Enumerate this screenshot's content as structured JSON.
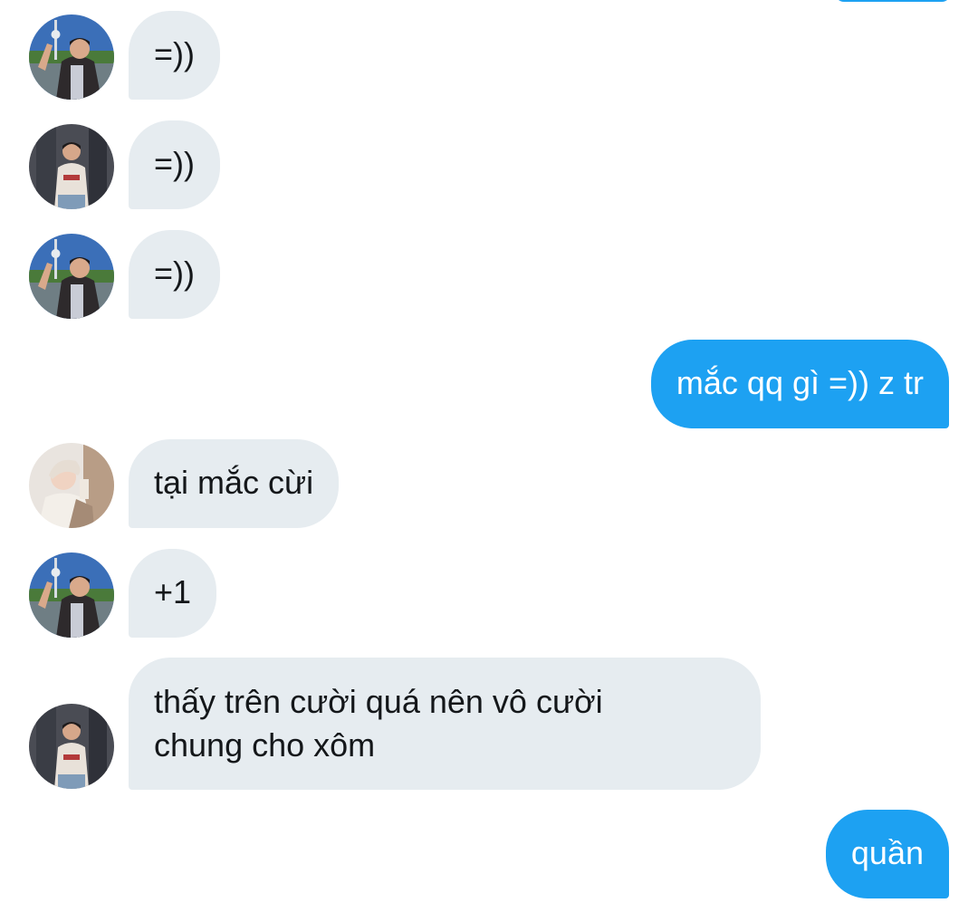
{
  "colors": {
    "incoming_bubble": "#e6ecf0",
    "outgoing_bubble": "#1da1f2",
    "incoming_text": "#14171a",
    "outgoing_text": "#ffffff"
  },
  "messages": [
    {
      "side": "incoming",
      "avatar": "selfie-blue-sky-avatar",
      "text": "=))"
    },
    {
      "side": "incoming",
      "avatar": "mirror-selfie-avatar",
      "text": "=))"
    },
    {
      "side": "incoming",
      "avatar": "selfie-blue-sky-avatar",
      "text": "=))"
    },
    {
      "side": "outgoing",
      "text": "mắc qq gì =)) z tr"
    },
    {
      "side": "incoming",
      "avatar": "light-hair-portrait-avatar",
      "text": "tại mắc cừi"
    },
    {
      "side": "incoming",
      "avatar": "selfie-blue-sky-avatar",
      "text": "+1"
    },
    {
      "side": "incoming",
      "avatar": "mirror-selfie-avatar",
      "text_line1": "thấy trên cười quá nên vô cười",
      "text_line2": "chung cho xôm"
    },
    {
      "side": "outgoing",
      "text": "quần"
    }
  ]
}
